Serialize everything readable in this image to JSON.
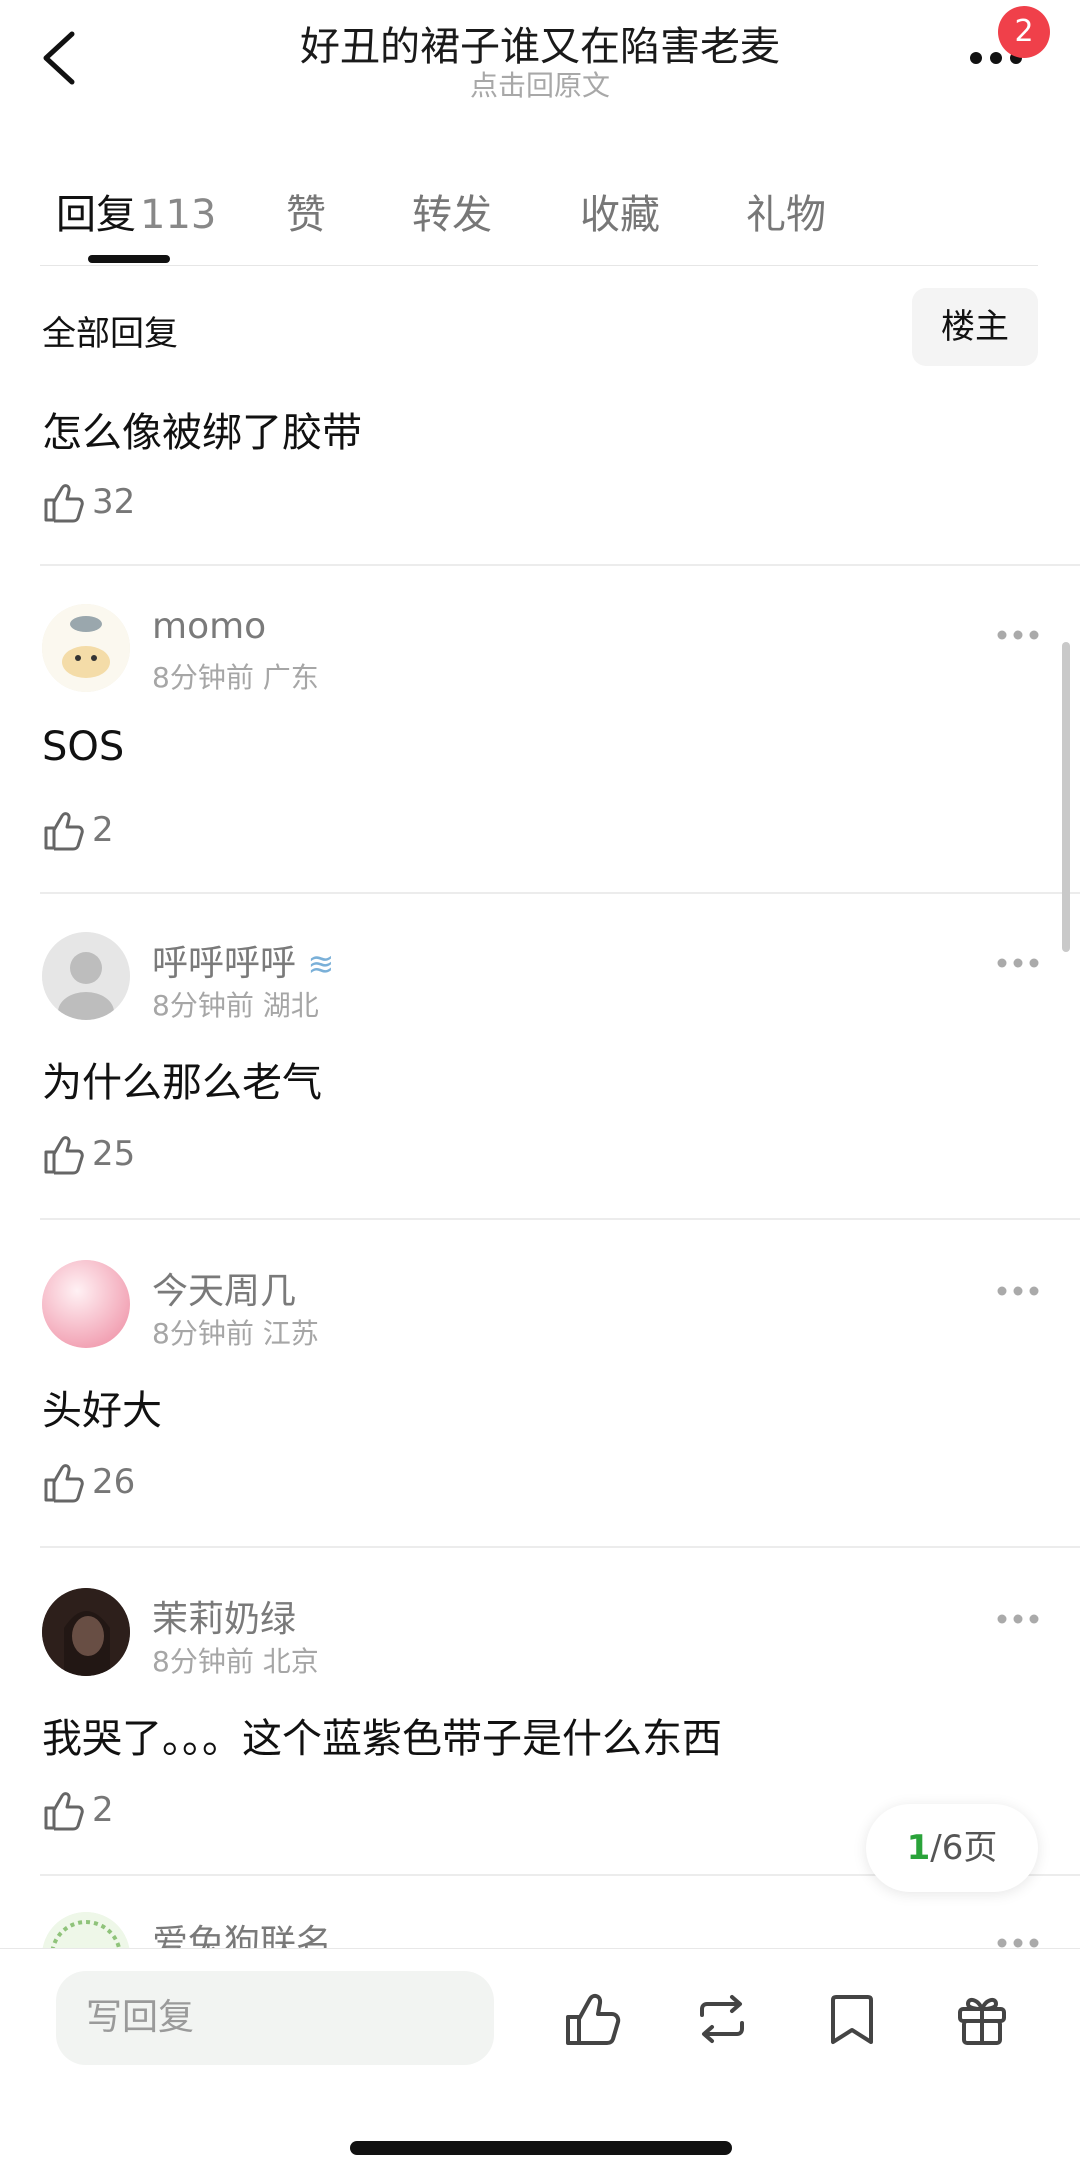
{
  "header": {
    "title": "好丑的裙子谁又在陷害老麦",
    "subtitle": "点击回原文",
    "badge_count": "2"
  },
  "tabs": [
    {
      "label": "回复",
      "count": "113"
    },
    {
      "label": "赞"
    },
    {
      "label": "转发"
    },
    {
      "label": "收藏"
    },
    {
      "label": "礼物"
    }
  ],
  "filter": {
    "all_label": "全部回复",
    "owner_label": "楼主"
  },
  "comments": [
    {
      "text": "怎么像被绑了胶带",
      "likes": "32"
    },
    {
      "username": "momo",
      "time": "8分钟前",
      "location": "广东",
      "text": "SOS",
      "likes": "2"
    },
    {
      "username": "呼呼呼呼",
      "time": "8分钟前",
      "location": "湖北",
      "text": "为什么那么老气",
      "likes": "25"
    },
    {
      "username": "今天周几",
      "time": "8分钟前",
      "location": "江苏",
      "text": "头好大",
      "likes": "26"
    },
    {
      "username": "茉莉奶绿",
      "time": "8分钟前",
      "location": "北京",
      "text": "我哭了。。。这个蓝紫色带子是什么东西",
      "likes": "2"
    },
    {
      "username": "爱兔狗联名"
    }
  ],
  "pager": {
    "current": "1",
    "total_text": "/6页"
  },
  "bottom": {
    "reply_placeholder": "写回复",
    "icons": [
      "like-icon",
      "repost-icon",
      "bookmark-icon",
      "gift-icon"
    ]
  },
  "colors": {
    "badge": "#f0404a",
    "pager_current": "#2aa33a"
  }
}
